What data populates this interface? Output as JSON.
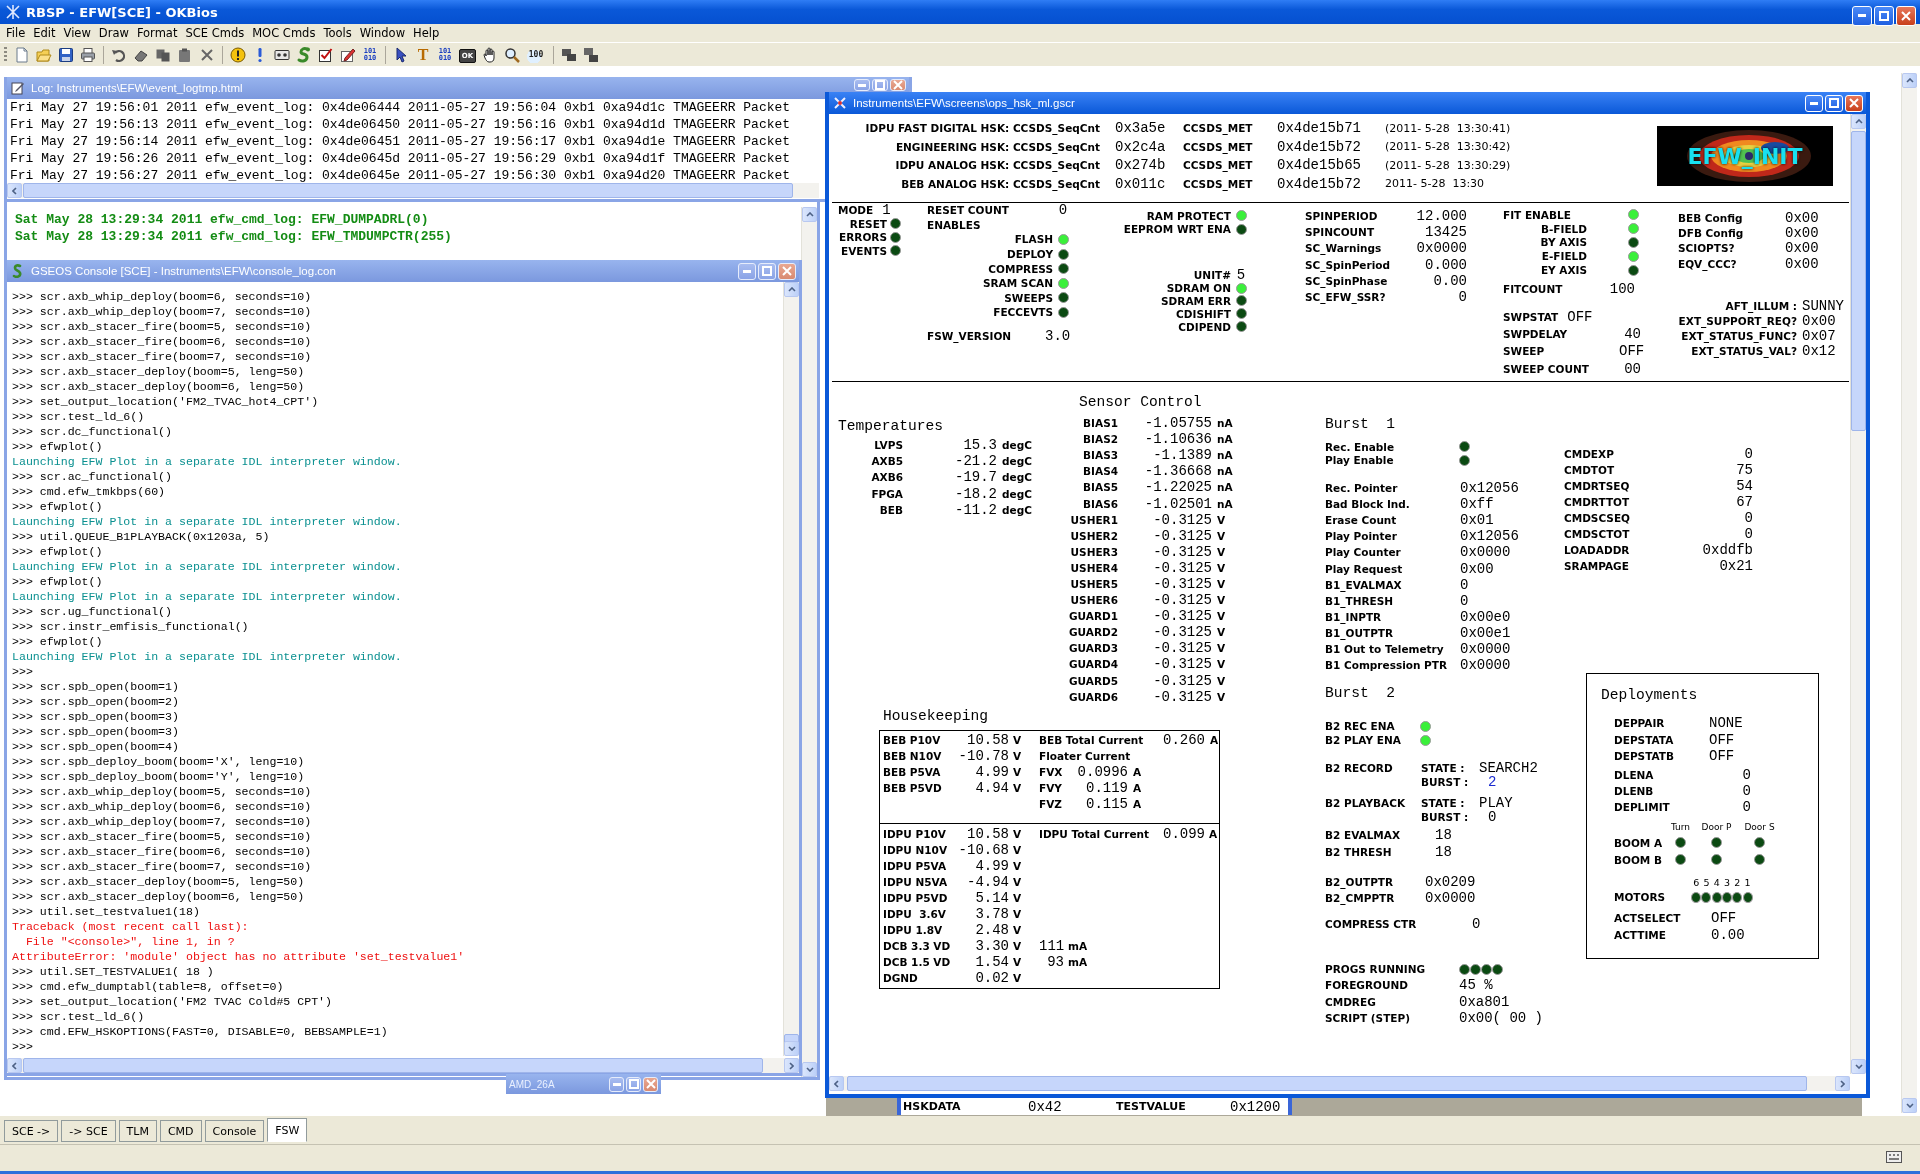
{
  "app_title": "RBSP - EFW[SCE] - OKBios",
  "menu": [
    "File",
    "Edit",
    "View",
    "Draw",
    "Format",
    "SCE Cmds",
    "MOC Cmds",
    "Tools",
    "Window",
    "Help"
  ],
  "toolbar": [
    {
      "kind": "new"
    },
    {
      "kind": "open"
    },
    {
      "kind": "save"
    },
    {
      "kind": "print"
    },
    {
      "kind": "separator"
    },
    {
      "kind": "undo"
    },
    {
      "kind": "erase"
    },
    {
      "kind": "copy"
    },
    {
      "kind": "paste"
    },
    {
      "kind": "delete"
    },
    {
      "kind": "separator"
    },
    {
      "kind": "warning"
    },
    {
      "kind": "alert"
    },
    {
      "kind": "tape"
    },
    {
      "kind": "snake"
    },
    {
      "kind": "check"
    },
    {
      "kind": "edit"
    },
    {
      "kind": "binary",
      "glyph": [
        "101",
        "010"
      ]
    },
    {
      "kind": "separator"
    },
    {
      "kind": "pointer"
    },
    {
      "kind": "text",
      "glyph": [
        "T"
      ]
    },
    {
      "kind": "binary",
      "glyph": [
        "101",
        "010"
      ]
    },
    {
      "kind": "ok",
      "glyph": [
        "OK"
      ]
    },
    {
      "kind": "hand"
    },
    {
      "kind": "zoom"
    },
    {
      "kind": "zoom_level",
      "glyph": [
        "100"
      ]
    },
    {
      "kind": "separator"
    },
    {
      "kind": "cascade"
    },
    {
      "kind": "tile"
    }
  ],
  "event_log": {
    "title": "Log: Instruments\\EFW\\event_logtmp.html",
    "lines": [
      "Fri May 27 19:56:01 2011 efw_event_log: 0x4de06444 2011-05-27 19:56:04 0xb1 0xa94d1c TMAGEERR Packet",
      "Fri May 27 19:56:13 2011 efw_event_log: 0x4de06450 2011-05-27 19:56:16 0xb1 0xa94d1d TMAGEERR Packet",
      "Fri May 27 19:56:14 2011 efw_event_log: 0x4de06451 2011-05-27 19:56:17 0xb1 0xa94d1e TMAGEERR Packet",
      "Fri May 27 19:56:26 2011 efw_event_log: 0x4de0645d 2011-05-27 19:56:29 0xb1 0xa94d1f TMAGEERR Packet",
      "Fri May 27 19:56:27 2011 efw_event_log: 0x4de0645e 2011-05-27 19:56:30 0xb1 0xa94d20 TMAGEERR Packet"
    ]
  },
  "cmd_log": {
    "lines": [
      "Sat May 28 13:29:34 2011 efw_cmd_log: EFW_DUMPADRL(0)",
      "Sat May 28 13:29:34 2011 efw_cmd_log: EFW_TMDUMPCTR(255)"
    ]
  },
  "console": {
    "title": "GSEOS Console  [SCE] - Instruments\\EFW\\console_log.con",
    "lines": [
      {
        "kind": "input",
        "text": ">>> scr.axb_whip_deploy(boom=6, seconds=10)"
      },
      {
        "kind": "input",
        "text": ">>> scr.axb_whip_deploy(boom=7, seconds=10)"
      },
      {
        "kind": "input",
        "text": ">>> scr.axb_stacer_fire(boom=5, seconds=10)"
      },
      {
        "kind": "input",
        "text": ">>> scr.axb_stacer_fire(boom=6, seconds=10)"
      },
      {
        "kind": "input",
        "text": ">>> scr.axb_stacer_fire(boom=7, seconds=10)"
      },
      {
        "kind": "input",
        "text": ">>> scr.axb_stacer_deploy(boom=5, leng=50)"
      },
      {
        "kind": "input",
        "text": ">>> scr.axb_stacer_deploy(boom=6, leng=50)"
      },
      {
        "kind": "input",
        "text": ">>> set_output_location('FM2_TVAC_hot4_CPT')"
      },
      {
        "kind": "input",
        "text": ">>> scr.test_ld_6()"
      },
      {
        "kind": "input",
        "text": ">>> scr.dc_functional()"
      },
      {
        "kind": "input",
        "text": ">>> efwplot()"
      },
      {
        "kind": "info",
        "text": "Launching EFW Plot in a separate IDL interpreter window."
      },
      {
        "kind": "input",
        "text": ">>> scr.ac_functional()"
      },
      {
        "kind": "input",
        "text": ">>> cmd.efw_tmkbps(60)"
      },
      {
        "kind": "input",
        "text": ">>> efwplot()"
      },
      {
        "kind": "info",
        "text": "Launching EFW Plot in a separate IDL interpreter window."
      },
      {
        "kind": "input",
        "text": ">>> util.QUEUE_B1PLAYBACK(0x1203a, 5)"
      },
      {
        "kind": "input",
        "text": ">>> efwplot()"
      },
      {
        "kind": "info",
        "text": "Launching EFW Plot in a separate IDL interpreter window."
      },
      {
        "kind": "input",
        "text": ">>> efwplot()"
      },
      {
        "kind": "info",
        "text": "Launching EFW Plot in a separate IDL interpreter window."
      },
      {
        "kind": "input",
        "text": ">>> scr.ug_functional()"
      },
      {
        "kind": "input",
        "text": ">>> scr.instr_emfisis_functional()"
      },
      {
        "kind": "input",
        "text": ">>> efwplot()"
      },
      {
        "kind": "info",
        "text": "Launching EFW Plot in a separate IDL interpreter window."
      },
      {
        "kind": "input",
        "text": ">>>"
      },
      {
        "kind": "input",
        "text": ">>> scr.spb_open(boom=1)"
      },
      {
        "kind": "input",
        "text": ">>> scr.spb_open(boom=2)"
      },
      {
        "kind": "input",
        "text": ">>> scr.spb_open(boom=3)"
      },
      {
        "kind": "input",
        "text": ">>> scr.spb_open(boom=3)"
      },
      {
        "kind": "input",
        "text": ">>> scr.spb_open(boom=4)"
      },
      {
        "kind": "input",
        "text": ">>> scr.spb_deploy_boom(boom='X', leng=10)"
      },
      {
        "kind": "input",
        "text": ">>> scr.spb_deploy_boom(boom='Y', leng=10)"
      },
      {
        "kind": "input",
        "text": ">>> scr.axb_whip_deploy(boom=5, seconds=10)"
      },
      {
        "kind": "input",
        "text": ">>> scr.axb_whip_deploy(boom=6, seconds=10)"
      },
      {
        "kind": "input",
        "text": ">>> scr.axb_whip_deploy(boom=7, seconds=10)"
      },
      {
        "kind": "input",
        "text": ">>> scr.axb_stacer_fire(boom=5, seconds=10)"
      },
      {
        "kind": "input",
        "text": ">>> scr.axb_stacer_fire(boom=6, seconds=10)"
      },
      {
        "kind": "input",
        "text": ">>> scr.axb_stacer_fire(boom=7, seconds=10)"
      },
      {
        "kind": "input",
        "text": ">>> scr.axb_stacer_deploy(boom=5, leng=50)"
      },
      {
        "kind": "input",
        "text": ">>> scr.axb_stacer_deploy(boom=6, leng=50)"
      },
      {
        "kind": "input",
        "text": ">>> util.set_testvalue1(18)"
      },
      {
        "kind": "error",
        "text": "Traceback (most recent call last):"
      },
      {
        "kind": "error",
        "text": "  File \"<console>\", line 1, in ?"
      },
      {
        "kind": "error",
        "text": "AttributeError: 'module' object has no attribute 'set_testvalue1'"
      },
      {
        "kind": "input",
        "text": ">>> util.SET_TESTVALUE1( 18 )"
      },
      {
        "kind": "input",
        "text": ">>> cmd.efw_dumptabl(table=8, offset=0)"
      },
      {
        "kind": "input",
        "text": ">>> set_output_location('FM2 TVAC Cold#5 CPT')"
      },
      {
        "kind": "input",
        "text": ">>> scr.test_ld_6()"
      },
      {
        "kind": "input",
        "text": ">>> cmd.EFW_HSKOPTIONS(FAST=0, DISABLE=0, BEBSAMPLE=1)"
      },
      {
        "kind": "input",
        "text": ">>>"
      }
    ]
  },
  "minimized_window": {
    "title": "AMD_26A"
  },
  "hsk_window": {
    "title": "Instruments\\EFW\\screens\\ops_hsk_ml.gscr",
    "header_rows": [
      {
        "label": "IDPU FAST DIGITAL HSK: CCSDS_SeqCnt",
        "seqcnt": "0x3a5e",
        "met_label": "CCSDS_MET",
        "met": "0x4de15b71",
        "time": "(2011- 5-28  13:30:41)"
      },
      {
        "label": "ENGINEERING HSK: CCSDS_SeqCnt",
        "seqcnt": "0x2c4a",
        "met_label": "CCSDS_MET",
        "met": "0x4de15b72",
        "time": "(2011- 5-28  13:30:42)"
      },
      {
        "label": "IDPU ANALOG HSK: CCSDS_SeqCnt",
        "seqcnt": "0x274b",
        "met_label": "CCSDS_MET",
        "met": "0x4de15b65",
        "time": "(2011- 5-28  13:30:29)"
      },
      {
        "label": "BEB ANALOG HSK: CCSDS_SeqCnt",
        "seqcnt": "0x011c",
        "met_label": "CCSDS_MET",
        "met": "0x4de15b72",
        "time": "2011- 5-28  13:30"
      }
    ],
    "logo": {
      "text": "EFW_INIT"
    },
    "mode": {
      "label": "MODE",
      "value": "1"
    },
    "status_leds": [
      {
        "label": "RESET",
        "on": false
      },
      {
        "label": "ERRORS",
        "on": false
      },
      {
        "label": "EVENTS",
        "on": false
      }
    ],
    "reset_count": {
      "label": "RESET COUNT",
      "value": "0"
    },
    "enables": {
      "title": "ENABLES",
      "items": [
        {
          "label": "FLASH",
          "on": true
        },
        {
          "label": "DEPLOY",
          "on": false
        },
        {
          "label": "COMPRESS",
          "on": false
        },
        {
          "label": "SRAM SCAN",
          "on": true
        },
        {
          "label": "SWEEPS",
          "on": false
        },
        {
          "label": "FECCEVTS",
          "on": false
        }
      ]
    },
    "fsw_version": {
      "label": "FSW_VERSION",
      "value": "3.0"
    },
    "protect_leds": [
      {
        "label": "RAM PROTECT",
        "on": true
      },
      {
        "label": "EEPROM WRT ENA",
        "on": false
      }
    ],
    "unit": {
      "label": "UNIT#",
      "value": "5"
    },
    "sdram_leds": [
      {
        "label": "SDRAM ON",
        "on": true
      },
      {
        "label": "SDRAM ERR",
        "on": false
      },
      {
        "label": "CDISHIFT",
        "on": false
      },
      {
        "label": "CDIPEND",
        "on": false
      }
    ],
    "spin": [
      {
        "label": "SPINPERIOD",
        "value": "12.000"
      },
      {
        "label": "SPINCOUNT",
        "value": "13425"
      },
      {
        "label": "SC_Warnings",
        "value": "0x0000"
      },
      {
        "label": "SC_SpinPeriod",
        "value": "0.000"
      },
      {
        "label": "SC_SpinPhase",
        "value": "0.00"
      },
      {
        "label": "SC_EFW_SSR?",
        "value": "0"
      }
    ],
    "fit_enable": {
      "label": "FIT ENABLE",
      "on": true
    },
    "fit_fields": [
      {
        "label": "B-FIELD",
        "on": true
      },
      {
        "label": "BY AXIS",
        "on": false
      },
      {
        "label": "E-FIELD",
        "on": true
      },
      {
        "label": "EY AXIS",
        "on": false
      }
    ],
    "fitcount": {
      "label": "FITCOUNT",
      "value": "100"
    },
    "sweep": [
      {
        "kind": "inline",
        "label": "SWPSTAT",
        "value": "OFF"
      },
      {
        "kind": "field",
        "label": "SWPDELAY",
        "value": "40"
      },
      {
        "kind": "field",
        "label": "SWEEP",
        "value": "OFF"
      },
      {
        "kind": "field",
        "label": "SWEEP COUNT",
        "value": "00"
      }
    ],
    "config": [
      {
        "label": "BEB Config",
        "value": "0x00"
      },
      {
        "label": "DFB Config",
        "value": "0x00"
      },
      {
        "label": "SCIOPTS?",
        "value": "0x00"
      },
      {
        "label": "EQV_CCC?",
        "value": "0x00"
      }
    ],
    "ext": [
      {
        "label": "AFT_ILLUM :",
        "value": "SUNNY"
      },
      {
        "label": "EXT_SUPPORT_REQ?",
        "value": "0x00"
      },
      {
        "label": "EXT_STATUS_FUNC?",
        "value": "0x07"
      },
      {
        "label": "EXT_STATUS_VAL?",
        "value": "0x12"
      }
    ],
    "temperatures": {
      "title": "Temperatures",
      "rows": [
        {
          "label": "LVPS",
          "value": "15.3",
          "unit": "degC"
        },
        {
          "label": "AXB5",
          "value": "-21.2",
          "unit": "degC"
        },
        {
          "label": "AXB6",
          "value": "-19.7",
          "unit": "degC"
        },
        {
          "label": "FPGA",
          "value": "-18.2",
          "unit": "degC"
        },
        {
          "label": "BEB",
          "value": "-11.2",
          "unit": "degC"
        }
      ]
    },
    "sensor_control": {
      "title": "Sensor Control",
      "rows": [
        {
          "label": "BIAS1",
          "value": "-1.05755",
          "unit": "nA"
        },
        {
          "label": "BIAS2",
          "value": "-1.10636",
          "unit": "nA"
        },
        {
          "label": "BIAS3",
          "value": "-1.1389",
          "unit": "nA"
        },
        {
          "label": "BIAS4",
          "value": "-1.36668",
          "unit": "nA"
        },
        {
          "label": "BIAS5",
          "value": "-1.22025",
          "unit": "nA"
        },
        {
          "label": "BIAS6",
          "value": "-1.02501",
          "unit": "nA"
        },
        {
          "label": "USHER1",
          "value": "-0.3125",
          "unit": "V"
        },
        {
          "label": "USHER2",
          "value": "-0.3125",
          "unit": "V"
        },
        {
          "label": "USHER3",
          "value": "-0.3125",
          "unit": "V"
        },
        {
          "label": "USHER4",
          "value": "-0.3125",
          "unit": "V"
        },
        {
          "label": "USHER5",
          "value": "-0.3125",
          "unit": "V"
        },
        {
          "label": "USHER6",
          "value": "-0.3125",
          "unit": "V"
        },
        {
          "label": "GUARD1",
          "value": "-0.3125",
          "unit": "V"
        },
        {
          "label": "GUARD2",
          "value": "-0.3125",
          "unit": "V"
        },
        {
          "label": "GUARD3",
          "value": "-0.3125",
          "unit": "V"
        },
        {
          "label": "GUARD4",
          "value": "-0.3125",
          "unit": "V"
        },
        {
          "label": "GUARD5",
          "value": "-0.3125",
          "unit": "V"
        },
        {
          "label": "GUARD6",
          "value": "-0.3125",
          "unit": "V"
        }
      ]
    },
    "burst1": {
      "title": "Burst  1",
      "leds": [
        {
          "label": "Rec. Enable",
          "on": false
        },
        {
          "label": "Play Enable",
          "on": false
        }
      ],
      "rows": [
        {
          "label": "Rec. Pointer",
          "value": "0x12056"
        },
        {
          "label": "Bad Block Ind.",
          "value": "0xff"
        },
        {
          "label": "Erase Count",
          "value": "0x01"
        },
        {
          "label": "Play Pointer",
          "value": "0x12056"
        },
        {
          "label": "Play Counter",
          "value": "0x0000"
        },
        {
          "label": "Play Request",
          "value": "0x00"
        },
        {
          "label": "B1_EVALMAX",
          "value": "0"
        },
        {
          "label": "B1_THRESH",
          "value": "0"
        },
        {
          "label": "B1_INPTR",
          "value": "0x00e0"
        },
        {
          "label": "B1_OUTPTR",
          "value": "0x00e1"
        },
        {
          "label": "B1 Out to Telemetry",
          "value": "0x0000"
        },
        {
          "label": "B1 Compression PTR",
          "value": "0x0000"
        }
      ]
    },
    "counters": [
      {
        "label": "CMDEXP",
        "value": "0"
      },
      {
        "label": "CMDTOT",
        "value": "75"
      },
      {
        "label": "CMDRTSEQ",
        "value": "54"
      },
      {
        "label": "CMDRTTOT",
        "value": "67"
      },
      {
        "label": "CMDSCSEQ",
        "value": "0"
      },
      {
        "label": "CMDSCTOT",
        "value": "0"
      },
      {
        "label": "LOADADDR",
        "value": "0xddfb"
      },
      {
        "label": "SRAMPAGE",
        "value": "0x21"
      }
    ],
    "burst2": {
      "title": "Burst  2",
      "leds": [
        {
          "label": "B2 REC ENA",
          "on": true
        },
        {
          "label": "B2 PLAY ENA",
          "on": true
        }
      ],
      "modes": [
        {
          "label": "B2 RECORD",
          "state_label": "STATE :",
          "state": "SEARCH2",
          "burst_label": "BURST :",
          "burst": "2",
          "burst_highlighted": true
        },
        {
          "label": "B2 PLAYBACK",
          "state_label": "STATE :",
          "state": "PLAY",
          "burst_label": "BURST :",
          "burst": "0",
          "burst_highlighted": false
        }
      ],
      "limits": [
        {
          "label": "B2 EVALMAX",
          "value": "18"
        },
        {
          "label": "B2 THRESH",
          "value": "18"
        }
      ],
      "pointers": [
        {
          "label": "B2_OUTPTR",
          "value": "0x0209"
        },
        {
          "label": "B2_CMPPTR",
          "value": "0x0000"
        }
      ],
      "compress_ctr": {
        "label": "COMPRESS CTR",
        "value": "0"
      }
    },
    "progs": {
      "label": "PROGS RUNNING",
      "leds": [
        {
          "on": false
        },
        {
          "on": false
        },
        {
          "on": false
        },
        {
          "on": false
        }
      ]
    },
    "process_rows": [
      {
        "label": "FOREGROUND",
        "value": "45 %"
      },
      {
        "label": "CMDREG",
        "value": "0xa801"
      },
      {
        "label": "SCRIPT (STEP)",
        "value": "0x00( 00 )"
      }
    ],
    "deployments": {
      "title": "Deployments",
      "status": [
        {
          "label": "DEPPAIR",
          "value": "NONE"
        },
        {
          "label": "DEPSTATA",
          "value": "OFF"
        },
        {
          "label": "DEPSTATB",
          "value": "OFF"
        }
      ],
      "lengths": [
        {
          "label": "DLENA",
          "value": "0"
        },
        {
          "label": "DLENB",
          "value": "0"
        },
        {
          "label": "DEPLIMIT",
          "value": "0"
        }
      ],
      "boom_columns": [
        "Turn",
        "Door P",
        "Door S"
      ],
      "booms": [
        {
          "label": "BOOM A",
          "leds": [
            {
              "on": false
            },
            {
              "on": false
            },
            {
              "on": false
            }
          ]
        },
        {
          "label": "BOOM B",
          "leds": [
            {
              "on": false
            },
            {
              "on": false
            },
            {
              "on": false
            }
          ]
        }
      ],
      "motors": {
        "label": "MOTORS",
        "items": [
          {
            "number": "6",
            "on": false
          },
          {
            "number": "5",
            "on": false
          },
          {
            "number": "4",
            "on": false
          },
          {
            "number": "3",
            "on": false
          },
          {
            "number": "2",
            "on": false
          },
          {
            "number": "1",
            "on": false
          }
        ]
      },
      "actuator": [
        {
          "label": "ACTSELECT",
          "value": "OFF"
        },
        {
          "label": "ACTTIME",
          "value": "0.00"
        }
      ]
    },
    "housekeeping": {
      "title": "Housekeeping",
      "beb_rows": [
        {
          "label": "BEB P10V",
          "value": "10.58",
          "unit": "V"
        },
        {
          "label": "BEB N10V",
          "value": "-10.78",
          "unit": "V"
        },
        {
          "label": "BEB P5VA",
          "value": "4.99",
          "unit": "V"
        },
        {
          "label": "BEB P5VD",
          "value": "4.94",
          "unit": "V"
        }
      ],
      "beb_total": {
        "label": "BEB Total Current",
        "value": "0.260",
        "unit": "A"
      },
      "floater_title": "Floater Current",
      "floater_rows": [
        {
          "label": "FVX",
          "value": "0.0996",
          "unit": "A"
        },
        {
          "label": "FVY",
          "value": "0.119",
          "unit": "A"
        },
        {
          "label": "FVZ",
          "value": "0.115",
          "unit": "A"
        }
      ],
      "idpu_rows": [
        {
          "label": "IDPU P10V",
          "value": "10.58",
          "unit": "V"
        },
        {
          "label": "IDPU N10V",
          "value": "-10.68",
          "unit": "V"
        },
        {
          "label": "IDPU P5VA",
          "value": "4.99",
          "unit": "V"
        },
        {
          "label": "IDPU N5VA",
          "value": "-4.94",
          "unit": "V"
        },
        {
          "label": "IDPU P5VD",
          "value": "5.14",
          "unit": "V"
        },
        {
          "label": "IDPU  3.6V",
          "value": "3.78",
          "unit": "V"
        },
        {
          "label": "IDPU 1.8V",
          "value": "2.48",
          "unit": "V"
        },
        {
          "label": "DCB 3.3 VD",
          "value": "3.30",
          "unit": "V",
          "current": "111",
          "current_unit": "mA"
        },
        {
          "label": "DCB 1.5 VD",
          "value": "1.54",
          "unit": "V",
          "current": "93",
          "current_unit": "mA"
        },
        {
          "label": "DGND",
          "value": "0.02",
          "unit": "V"
        }
      ],
      "idpu_total": {
        "label": "IDPU Total Current",
        "value": "0.099",
        "unit": "A"
      }
    }
  },
  "hskdata_strip": [
    {
      "label": "HSKDATA",
      "value": "0x42"
    },
    {
      "label": "TESTVALUE",
      "value": "0x1200"
    }
  ],
  "bottom_tabs": [
    {
      "label": "SCE ->",
      "selected": false
    },
    {
      "label": "-> SCE",
      "selected": false
    },
    {
      "label": "TLM",
      "selected": false
    },
    {
      "label": "CMD",
      "selected": false
    },
    {
      "label": "Console",
      "selected": false
    },
    {
      "label": "FSW",
      "selected": true
    }
  ]
}
